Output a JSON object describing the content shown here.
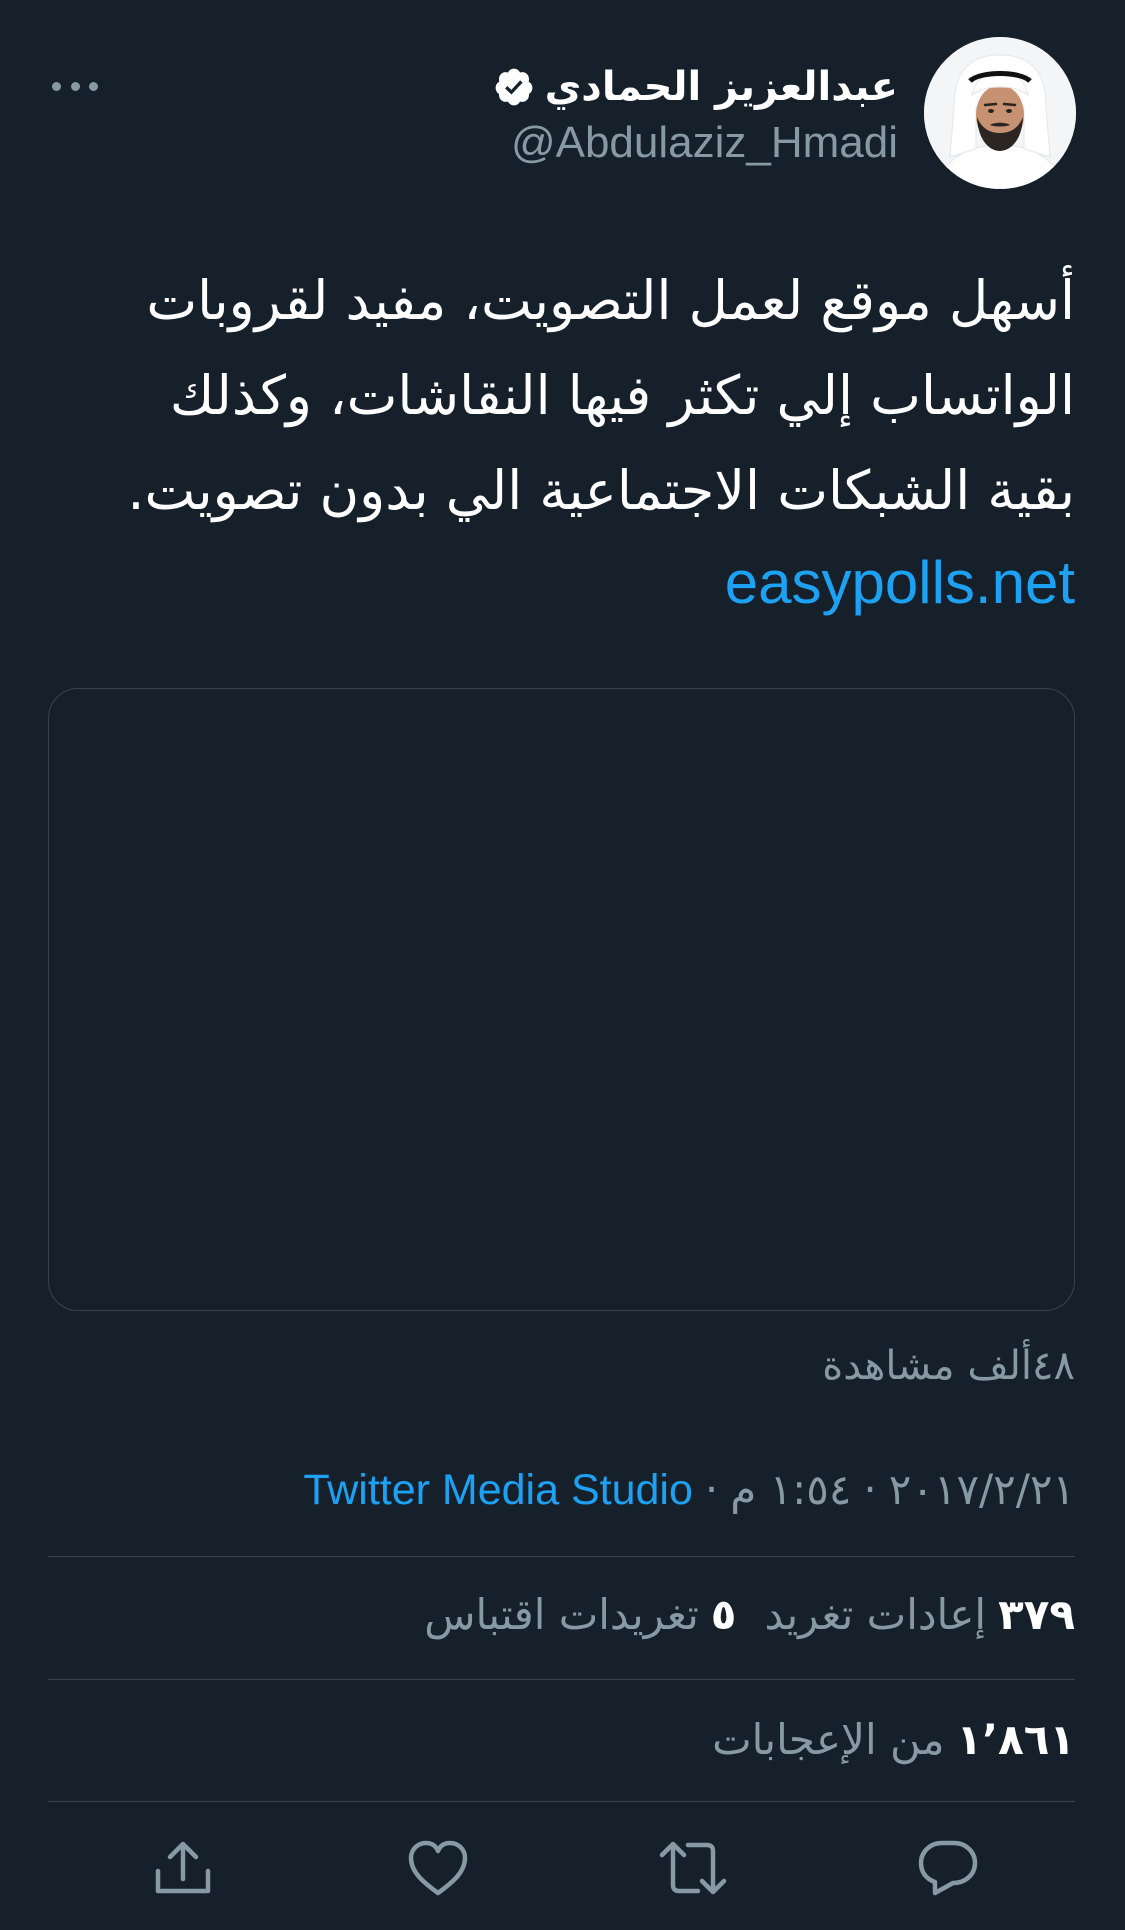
{
  "author": {
    "display_name": "عبدالعزيز الحمادي",
    "handle": "@Abdulaziz_Hmadi",
    "verified": true
  },
  "tweet": {
    "text": "أسهل موقع لعمل التصويت، مفيد لقروبات\nالواتساب إلي تكثر فيها النقاشات، وكذلك\nبقية الشبكات الاجتماعية الي بدون تصويت.",
    "link": "easypolls.net"
  },
  "views": "٤٨ألف مشاهدة",
  "meta": {
    "date": "٢٠١٧/٢/٢١",
    "time": "١:٥٤ م",
    "separator": "·",
    "source": "Twitter Media Studio"
  },
  "stats": {
    "retweets_count": "٣٧٩",
    "retweets_label": "إعادات تغريد",
    "quotes_count": "٥",
    "quotes_label": "تغريدات اقتباس",
    "likes_count": "١٬٨٦١",
    "likes_label": "من الإعجابات"
  },
  "icons": {
    "more": "more-icon",
    "verified": "verified-badge-icon",
    "reply": "reply-icon",
    "retweet": "retweet-icon",
    "like": "like-icon",
    "share": "share-icon"
  },
  "colors": {
    "background": "#15202b",
    "accent": "#1da1f2",
    "secondary_text": "#8899a6",
    "divider": "#38444d"
  }
}
